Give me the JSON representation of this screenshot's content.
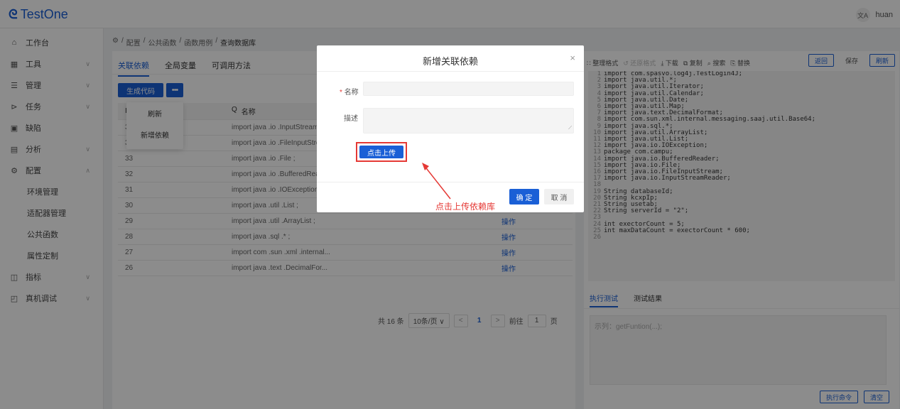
{
  "header": {
    "logo_text": "TestOne",
    "translate_icon_text": "文A",
    "user": "huan"
  },
  "sidebar": {
    "items": [
      {
        "label": "工作台",
        "icon": "⌂",
        "chev": ""
      },
      {
        "label": "工具",
        "icon": "▦",
        "chev": "∨"
      },
      {
        "label": "管理",
        "icon": "☰",
        "chev": "∨"
      },
      {
        "label": "任务",
        "icon": "⊳",
        "chev": "∨"
      },
      {
        "label": "缺陷",
        "icon": "▣",
        "chev": ""
      },
      {
        "label": "分析",
        "icon": "▤",
        "chev": "∨"
      },
      {
        "label": "配置",
        "icon": "⚙",
        "chev": "∧"
      }
    ],
    "subitems": [
      "环境管理",
      "适配器管理",
      "公共函数",
      "属性定制"
    ],
    "items_bottom": [
      {
        "label": "指标",
        "icon": "◫",
        "chev": "∨"
      },
      {
        "label": "真机调试",
        "icon": "◰",
        "chev": "∨"
      }
    ]
  },
  "breadcrumb": [
    "⚙",
    "/",
    "配置",
    "/",
    "公共函数",
    "/",
    "函数用例",
    "/",
    "查询数据库"
  ],
  "left": {
    "tabs": [
      "关联依赖",
      "全局变量",
      "可调用方法"
    ],
    "gen_button": "生成代码",
    "more_button": "•••",
    "dropdown": [
      "刷新",
      "新增依赖"
    ],
    "table": {
      "headers": {
        "id": "ID",
        "name": "名称",
        "name_icon": "Q"
      },
      "rows": [
        {
          "id": "35",
          "name": "import java .io .InputStreamR...",
          "op": ""
        },
        {
          "id": "34",
          "name": "import java .io .FileInputStrea...",
          "op": ""
        },
        {
          "id": "33",
          "name": "import java .io .File ;",
          "op": ""
        },
        {
          "id": "32",
          "name": "import java .io .BufferedRead...",
          "op": ""
        },
        {
          "id": "31",
          "name": "import java .io .IOException ;",
          "op": ""
        },
        {
          "id": "30",
          "name": "import java .util .List ;",
          "op": ""
        },
        {
          "id": "29",
          "name": "import java .util .ArrayList ;",
          "op": "操作"
        },
        {
          "id": "28",
          "name": "import java .sql .* ;",
          "op": "操作"
        },
        {
          "id": "27",
          "name": "import com .sun .xml .internal...",
          "op": "操作"
        },
        {
          "id": "26",
          "name": "import java .text .DecimalFor...",
          "op": "操作"
        }
      ]
    },
    "pager": {
      "total": "共 16 条",
      "size": "10条/页 ∨",
      "prev": "<",
      "page": "1",
      "next": ">",
      "goto": "前往",
      "goto_value": "1",
      "page_suffix": "页"
    }
  },
  "right": {
    "toolbar": [
      "整理格式",
      "还原格式",
      "下载",
      "复制",
      "搜索",
      "替换"
    ],
    "buttons": [
      "返回",
      "保存",
      "刷新"
    ],
    "code": [
      [
        "1",
        "import com.spasvo.log4j.TestLogin4J;"
      ],
      [
        "2",
        "import java.util.*;"
      ],
      [
        "3",
        "import java.util.Iterator;"
      ],
      [
        "4",
        "import java.util.Calendar;"
      ],
      [
        "5",
        "import java.util.Date;"
      ],
      [
        "6",
        "import java.util.Map;"
      ],
      [
        "7",
        "import java.text.DecimalFormat;"
      ],
      [
        "8",
        "import com.sun.xml.internal.messaging.saaj.util.Base64;"
      ],
      [
        "9",
        "import java.sql.*;"
      ],
      [
        "10",
        "import java.util.ArrayList;"
      ],
      [
        "11",
        "import java.util.List;"
      ],
      [
        "12",
        "import java.io.IOException;"
      ],
      [
        "13",
        "package com.campu;"
      ],
      [
        "14",
        "import java.io.BufferedReader;"
      ],
      [
        "15",
        "import java.io.File;"
      ],
      [
        "16",
        "import java.io.FileInputStream;"
      ],
      [
        "17",
        "import java.io.InputStreamReader;"
      ],
      [
        "18",
        ""
      ],
      [
        "19",
        "String databaseId;"
      ],
      [
        "20",
        "String kcxpIp;"
      ],
      [
        "21",
        "String usetab;"
      ],
      [
        "22",
        "String serverId = \"2\";"
      ],
      [
        "23",
        ""
      ],
      [
        "24",
        "int exectorCount = 5;"
      ],
      [
        "25",
        "int maxDataCount = exectorCount * 600;"
      ],
      [
        "26",
        ""
      ]
    ],
    "tabs": [
      "执行测试",
      "测试结果"
    ],
    "placeholder": "示列：getFuntion(...);",
    "run_button": "执行命令",
    "clear_button": "清空"
  },
  "modal": {
    "title": "新增关联依赖",
    "close": "×",
    "name_label": "名称",
    "required_mark": "*",
    "desc_label": "描述",
    "upload_button": "点击上传",
    "ok": "确 定",
    "cancel": "取 消"
  },
  "annotation": {
    "text": "点击上传依赖库",
    "color": "#e53935"
  },
  "colors": {
    "primary": "#1a5fd6",
    "annotation": "#e53935"
  }
}
